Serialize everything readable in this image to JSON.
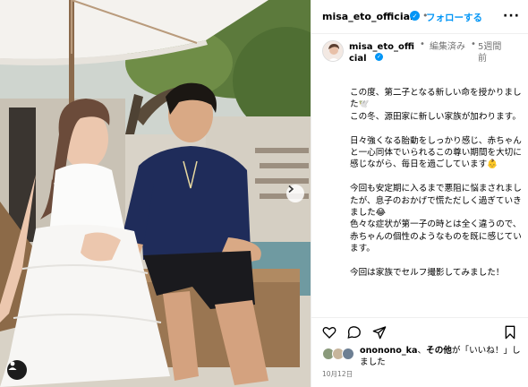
{
  "header": {
    "username": "misa_eto_official",
    "separator": "•",
    "follow_label": "フォローする",
    "more_icon": "more-horizontal-icon"
  },
  "caption_header": {
    "username": "misa_eto_official",
    "edited": "編集済み",
    "separator": "•",
    "time": "5週間前"
  },
  "caption": {
    "paragraphs": [
      "この度、第二子となる新しい命を授かりました🕊️\nこの冬、源田家に新しい家族が加わります。",
      "日々強くなる胎動をしっかり感じ、赤ちゃんと一心同体でいられるこの尊い期間を大切に感じながら、毎日を過ごしています👶",
      "今回も安定期に入るまで悪阻に悩まされましたが、息子のおかげで慌ただしく過ぎていきました😂\n色々な症状が第一子の時とは全く違うので、赤ちゃんの個性のようなものを既に感じています。",
      "今回は家族でセルフ撮影してみました！"
    ]
  },
  "actions": {
    "like_icon": "heart-icon",
    "comment_icon": "comment-icon",
    "share_icon": "send-icon",
    "save_icon": "bookmark-icon"
  },
  "likes": {
    "user": "ononono_ka",
    "others": "その他",
    "suffix": "が「いいね！」しました"
  },
  "date": "10月12日",
  "colors": {
    "accent": "#0095f6",
    "muted": "#737373"
  }
}
